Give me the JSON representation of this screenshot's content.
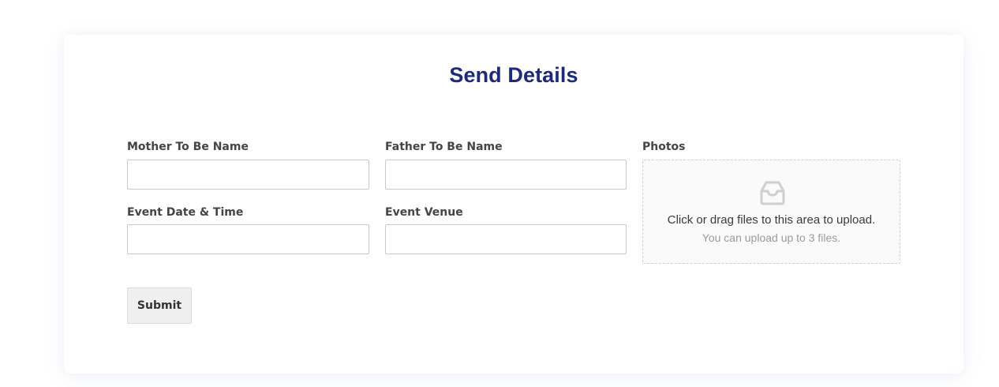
{
  "form": {
    "title": "Send Details",
    "fields": {
      "mother_name": {
        "label": "Mother To Be Name",
        "value": "",
        "placeholder": ""
      },
      "father_name": {
        "label": "Father To Be Name",
        "value": "",
        "placeholder": ""
      },
      "event_datetime": {
        "label": "Event Date & Time",
        "value": "",
        "placeholder": ""
      },
      "event_venue": {
        "label": "Event Venue",
        "value": "",
        "placeholder": ""
      }
    },
    "photos": {
      "label": "Photos",
      "icon": "inbox-icon",
      "main_text": "Click or drag files to this area to upload.",
      "sub_text": "You can upload up to 3 files."
    },
    "submit_label": "Submit"
  },
  "colors": {
    "title": "#1e2a78",
    "label": "#444444",
    "input_border": "#c8c8c8",
    "dropzone_bg": "#fafafa",
    "button_bg": "#efefef"
  }
}
